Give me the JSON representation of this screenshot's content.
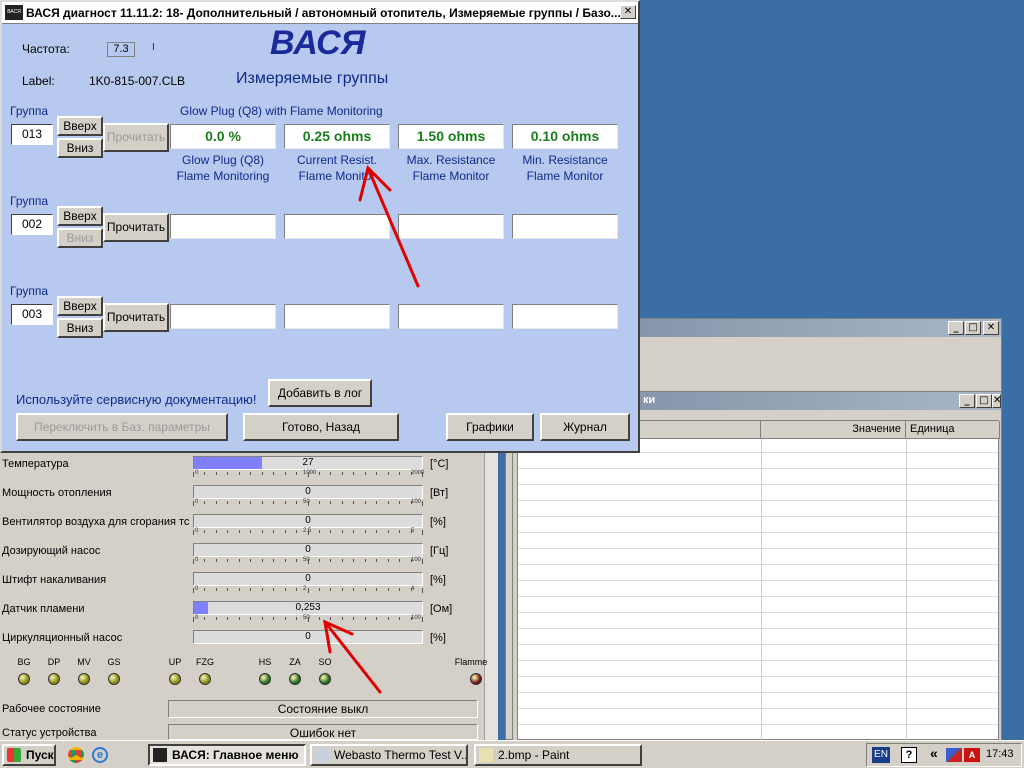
{
  "dialog": {
    "title": "ВАСЯ диагност 11.11.2: 18- Дополнительный / автономный отопитель,  Измеряемые группы / Базо...",
    "app_icon_text": "ВАСЯ",
    "close": "✕",
    "freq_label": "Частота:",
    "freq_value": "7.3",
    "freq_suffix": "I",
    "label_label": "Label:",
    "label_value": "1K0-815-007.CLB",
    "logo": "ВАСЯ",
    "subtitle": "Измеряемые группы",
    "group_header": "Glow Plug (Q8) with Flame Monitoring",
    "group_label": "Группа",
    "up_label": "Вверх",
    "down_label": "Вниз",
    "read_label": "Прочитать",
    "groups": [
      {
        "number": "013",
        "fields": [
          "0.0 %",
          "0.25 ohms",
          "1.50 ohms",
          "0.10 ohms"
        ],
        "captions": [
          [
            "Glow Plug (Q8)",
            "Flame Monitoring"
          ],
          [
            "Current Resist.",
            "Flame Monitor"
          ],
          [
            "Max. Resistance",
            "Flame Monitor"
          ],
          [
            "Min. Resistance",
            "Flame Monitor"
          ]
        ]
      },
      {
        "number": "002",
        "fields": [
          "",
          "",
          "",
          ""
        ]
      },
      {
        "number": "003",
        "fields": [
          "",
          "",
          "",
          ""
        ]
      }
    ],
    "doc_hint": "Используйте сервисную документацию!",
    "add_log": "Добавить в лог",
    "switch_basic": "Переключить в Баз. параметры",
    "done_back": "Готово, Назад",
    "graphs": "Графики",
    "journal": "Журнал"
  },
  "panel": {
    "rows": [
      {
        "label": "Температура",
        "value": "27",
        "unit": "[°C]",
        "fill": 0.3,
        "ticks": [
          "0",
          "1000",
          "2000"
        ]
      },
      {
        "label": "Мощность отопления",
        "value": "0",
        "unit": "[Вт]",
        "fill": 0,
        "ticks": [
          "0",
          "50",
          "100"
        ]
      },
      {
        "label": "Вентилятор воздуха для сгорания тс",
        "value": "0",
        "unit": "[%]",
        "fill": 0,
        "ticks": [
          "0",
          "2.5",
          "5"
        ]
      },
      {
        "label": "Дозирующий насос",
        "value": "0",
        "unit": "[Гц]",
        "fill": 0,
        "ticks": [
          "0",
          "50",
          "100"
        ]
      },
      {
        "label": "Штифт накаливания",
        "value": "0",
        "unit": "[%]",
        "fill": 0,
        "ticks": [
          "0",
          "2",
          "4"
        ]
      },
      {
        "label": "Датчик пламени",
        "value": "0,253",
        "unit": "[Ом]",
        "fill": 0.06,
        "ticks": [
          "0",
          "50",
          "100"
        ]
      },
      {
        "label": "Циркуляционный насос",
        "value": "0",
        "unit": "[%]",
        "fill": 0
      }
    ],
    "leds": [
      {
        "label": "BG",
        "color": "#8a8a10"
      },
      {
        "label": "DP",
        "color": "#8a8a10"
      },
      {
        "label": "MV",
        "color": "#8a8a10"
      },
      {
        "label": "GS",
        "color": "#8a8a10"
      },
      {
        "label": "UP",
        "color": "#8a8a10"
      },
      {
        "label": "FZG",
        "color": "#8a8a10"
      },
      {
        "label": "HS",
        "color": "#1f6e1f"
      },
      {
        "label": "ZA",
        "color": "#1f6e1f"
      },
      {
        "label": "SO",
        "color": "#1f6e1f"
      },
      {
        "label": "Flamme",
        "color": "#7a1010"
      }
    ],
    "work_state_label": "Рабочее состояние",
    "work_state_value": "Состояние выкл",
    "device_status_label": "Статус устройства",
    "device_status_value": "Ошибок нет"
  },
  "bgwindow": {
    "inner_title_tail": "ки",
    "col_value": "Значение",
    "col_unit": "Единица"
  },
  "taskbar": {
    "start": "Пуск",
    "items": [
      {
        "label": "ВАСЯ:  Главное меню",
        "active": true
      },
      {
        "label": "Webasto Thermo Test V...",
        "active": false
      },
      {
        "label": "2.bmp - Paint",
        "active": false
      }
    ],
    "lang": "EN",
    "help": "?",
    "tray_arrows": "«",
    "clock": "17:43"
  },
  "colors": {
    "desktop": "#3a6ea5",
    "dialog_bg": "#b7c9ee",
    "value_green": "#1a7e1a",
    "caption_blue": "#102a8c",
    "bar_fill": "#7f7fff",
    "arrow_red": "#e00000"
  }
}
